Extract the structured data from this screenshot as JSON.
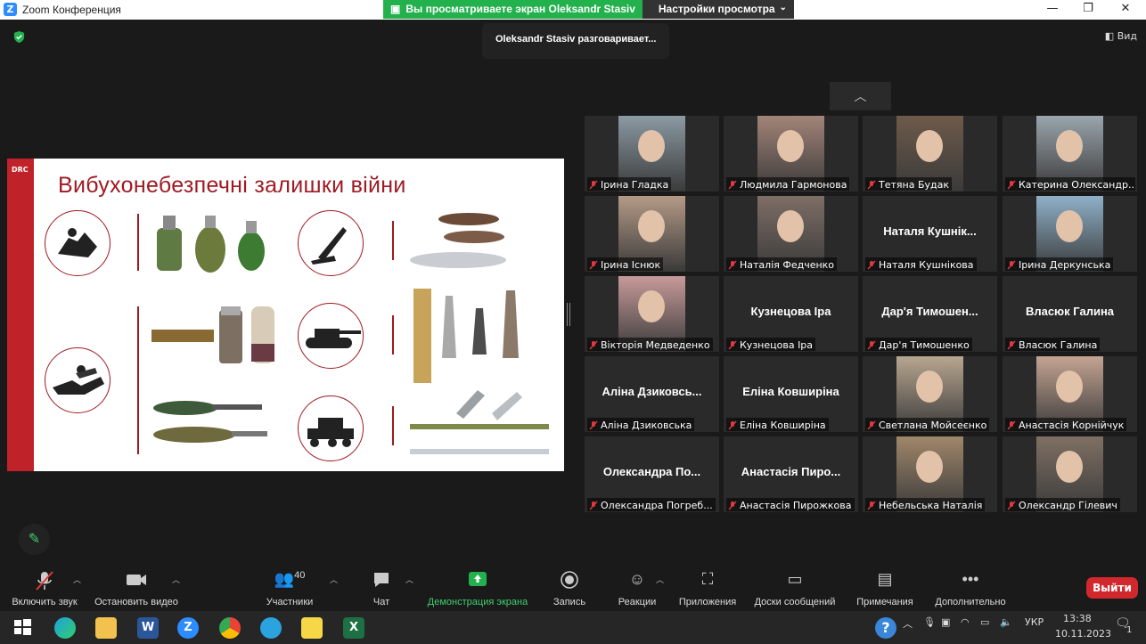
{
  "window": {
    "title": "Zoom Конференция",
    "logo_letter": "Z"
  },
  "share_banner": {
    "viewing_text": "Вы просматриваете экран Oleksandr Stasiv",
    "settings_label": "Настройки просмотра"
  },
  "talking_indicator": "Oleksandr Stasiv разговаривает...",
  "view_label": "Вид",
  "slide": {
    "corner_label": "DRC",
    "title": "Вибухонебезпечні залишки війни"
  },
  "participants": [
    {
      "name": "Ірина Гладка",
      "video": true,
      "bg": "#8b9aa3"
    },
    {
      "name": "Людмила Гармонова",
      "video": true,
      "bg": "#a38478"
    },
    {
      "name": "Тетяна Будак",
      "video": true,
      "bg": "#6e5a4a"
    },
    {
      "name": "Катерина Олександр...",
      "video": true,
      "bg": "#9aa5ad"
    },
    {
      "name": "Ірина Існюк",
      "video": true,
      "bg": "#b49a86"
    },
    {
      "name": "Наталія Федченко",
      "video": true,
      "bg": "#7e6e66"
    },
    {
      "name": "Наталя Кушнікова",
      "video": false,
      "display": "Наталя  Кушнік..."
    },
    {
      "name": "Ірина Деркунська",
      "video": true,
      "bg": "#8fb0c8"
    },
    {
      "name": "Вікторія Медведенко",
      "video": true,
      "bg": "#c79a9a"
    },
    {
      "name": "Кузнецова Іра",
      "video": false,
      "display": "Кузнецова Іра"
    },
    {
      "name": "Дар'я Тимошенко",
      "video": false,
      "display": "Дар'я  Тимошен..."
    },
    {
      "name": "Власюк Галина",
      "video": false,
      "display": "Власюк Галина"
    },
    {
      "name": "Аліна Дзиковська",
      "video": false,
      "display": "Аліна  Дзиковсь..."
    },
    {
      "name": "Еліна Ковширіна",
      "video": false,
      "display": "Еліна Ковширіна"
    },
    {
      "name": "Светлана Мойсеєнко",
      "video": true,
      "bg": "#b8a690"
    },
    {
      "name": "Анастасія Корнійчук",
      "video": true,
      "bg": "#c4a492"
    },
    {
      "name": "Олександра Погреб...",
      "video": false,
      "display": "Олександра  По..."
    },
    {
      "name": "Анастасія Пирожкова",
      "video": false,
      "display": "Анастасія  Пиро..."
    },
    {
      "name": "Небельська Наталія",
      "video": true,
      "bg": "#a0876a"
    },
    {
      "name": "Олександр Гілевич",
      "video": true,
      "bg": "#7f7063"
    }
  ],
  "toolbar": {
    "mute_label": "Включить звук",
    "video_label": "Остановить видео",
    "participants_label": "Участники",
    "participants_count": "40",
    "chat_label": "Чат",
    "share_label": "Демонстрация экрана",
    "record_label": "Запись",
    "reactions_label": "Реакции",
    "apps_label": "Приложения",
    "boards_label": "Доски сообщений",
    "notes_label": "Примечания",
    "more_label": "Дополнительно",
    "leave_label": "Выйти"
  },
  "taskbar": {
    "language": "УКР",
    "time": "13:38",
    "date": "10.11.2023",
    "notification_count": "1"
  },
  "colors": {
    "accent_green": "#23b14d",
    "leave_red": "#d0282d",
    "slide_red": "#c0222a"
  }
}
